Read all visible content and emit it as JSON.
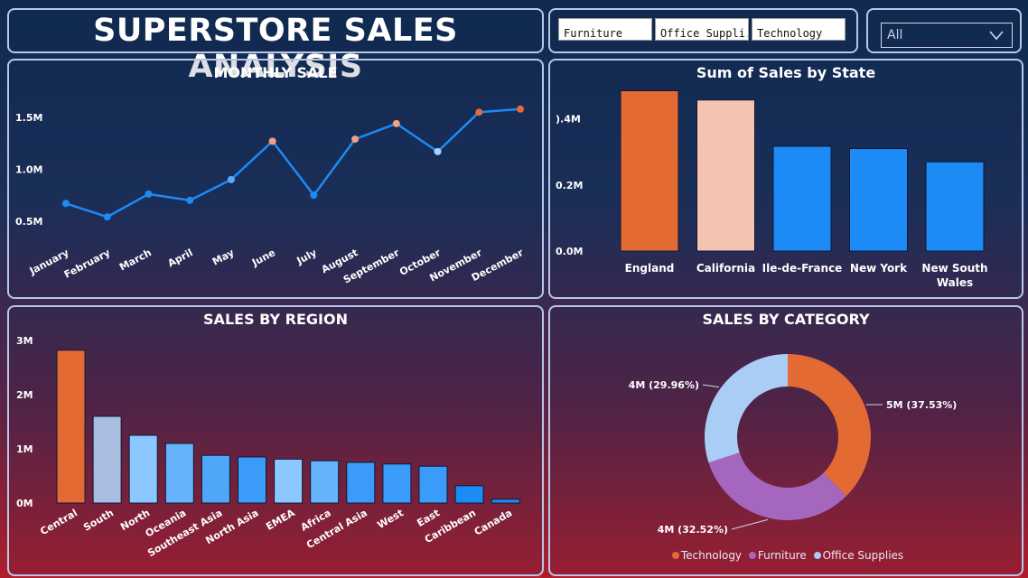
{
  "dashboard": {
    "title": "SUPERSTORE SALES ANALYSIS",
    "slicers": [
      "Furniture",
      "Office Suppli...",
      "Technology"
    ],
    "dropdown_value": "All"
  },
  "charts": {
    "monthly": {
      "title": "MONTHLY SALE"
    },
    "state": {
      "title": "Sum of Sales by State"
    },
    "region": {
      "title": "SALES BY REGION"
    },
    "category": {
      "title": "SALES BY CATEGORY"
    }
  },
  "colors": {
    "orange": "#e46a34",
    "peach": "#f4c4b0",
    "blue": "#1c8bf5",
    "lightblue": "#8cc8ff",
    "purple": "#a566bd",
    "pale": "#a9cdf5"
  },
  "chart_data": [
    {
      "id": "monthly",
      "type": "line",
      "title": "MONTHLY SALE",
      "x": [
        "January",
        "February",
        "March",
        "April",
        "May",
        "June",
        "July",
        "August",
        "September",
        "October",
        "November",
        "December"
      ],
      "values": [
        0.67,
        0.54,
        0.76,
        0.7,
        0.9,
        1.27,
        0.75,
        1.29,
        1.44,
        1.17,
        1.55,
        1.58
      ],
      "point_colors": [
        "#1c8bf5",
        "#1c8bf5",
        "#1c8bf5",
        "#1c8bf5",
        "#5aaaf8",
        "#f2a080",
        "#1c8bf5",
        "#f2a080",
        "#f2a080",
        "#a9d2ff",
        "#e46a34",
        "#e46a34"
      ],
      "yticks": [
        "0.5M",
        "1.0M",
        "1.5M"
      ],
      "ytick_values": [
        0.5,
        1.0,
        1.5
      ],
      "ylim": [
        0.35,
        1.7
      ],
      "ylabel": "",
      "xlabel": ""
    },
    {
      "id": "state",
      "type": "bar",
      "title": "Sum of Sales by State",
      "categories": [
        "England",
        "California",
        "Ile-de-France",
        "New York",
        "New South Wales"
      ],
      "values": [
        0.485,
        0.457,
        0.317,
        0.31,
        0.27
      ],
      "colors": [
        "#e46a34",
        "#f4c4b0",
        "#1c8bf5",
        "#1c8bf5",
        "#1c8bf5"
      ],
      "yticks": [
        ").4M",
        "0.2M",
        "0.0M"
      ],
      "ytick_values": [
        0.4,
        0.2,
        0.0
      ],
      "ylim": [
        0,
        0.5
      ]
    },
    {
      "id": "region",
      "type": "bar",
      "title": "SALES BY REGION",
      "categories": [
        "Central",
        "South",
        "North",
        "Oceania",
        "Southeast Asia",
        "North Asia",
        "EMEA",
        "Africa",
        "Central Asia",
        "West",
        "East",
        "Caribbean",
        "Canada"
      ],
      "values": [
        2.82,
        1.6,
        1.25,
        1.1,
        0.88,
        0.85,
        0.81,
        0.78,
        0.75,
        0.72,
        0.68,
        0.32,
        0.07
      ],
      "colors": [
        "#e46a34",
        "#a8bde0",
        "#8cc8ff",
        "#66b3fb",
        "#4fa7fa",
        "#3a9cf8",
        "#8cc8ff",
        "#66b3fb",
        "#3a9cf8",
        "#3a9cf8",
        "#3a9cf8",
        "#1c8bf5",
        "#1c8bf5"
      ],
      "yticks": [
        "0M",
        "1M",
        "2M",
        "3M"
      ],
      "ytick_values": [
        0,
        1,
        2,
        3
      ],
      "ylim": [
        0,
        3
      ]
    },
    {
      "id": "category",
      "type": "pie",
      "title": "SALES BY CATEGORY",
      "slices": [
        {
          "name": "Technology",
          "value": 37.53,
          "label": "5M (37.53%)",
          "color": "#e46a34"
        },
        {
          "name": "Furniture",
          "value": 32.52,
          "label": "4M (32.52%)",
          "color": "#a566bd"
        },
        {
          "name": "Office Supplies",
          "value": 29.96,
          "label": "4M (29.96%)",
          "color": "#a9cdf5"
        }
      ]
    }
  ]
}
